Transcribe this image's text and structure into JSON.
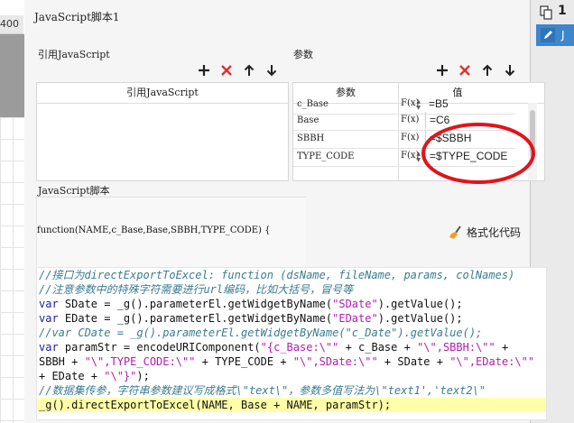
{
  "background": {
    "left_cell_text": "400",
    "right_number": "1",
    "right_item_text": "J"
  },
  "dialog": {
    "title": "JavaScript脚本1",
    "lib_section_label": "引用JavaScript",
    "params_section_label": "参数",
    "lib_table_header": "引用JavaScript",
    "params_header_name": "参数",
    "params_header_value": "值",
    "params": [
      {
        "name": "c_Base",
        "fx": "F(x)",
        "value": "=B5"
      },
      {
        "name": "Base",
        "fx": "F(x)",
        "value": "=C6"
      },
      {
        "name": "SBBH",
        "fx": "F(x)",
        "value": "=$SBBH"
      },
      {
        "name": "TYPE_CODE",
        "fx": "F(x)",
        "value": "=$TYPE_CODE"
      }
    ],
    "script_section_label": "JavaScript脚本",
    "function_signature": "function(NAME,c_Base,Base,SBBH,TYPE_CODE) {",
    "format_button_label": "格式化代码",
    "code_lines": [
      {
        "kind": "comment",
        "parts": [
          {
            "t": "cm",
            "s": "//接口为directExportToExcel: function (dsName, fileName, params, colNames)"
          }
        ]
      },
      {
        "kind": "comment",
        "parts": [
          {
            "t": "cm",
            "s": "//注意参数中的特殊字符需要进行url编码，比如大括号，冒号等"
          }
        ]
      },
      {
        "kind": "code",
        "parts": [
          {
            "t": "kw",
            "s": "var"
          },
          {
            "t": "tx",
            "s": " SDate = _g().parameterEl.getWidgetByName("
          },
          {
            "t": "str",
            "s": "\"SDate\""
          },
          {
            "t": "tx",
            "s": ").getValue();"
          }
        ]
      },
      {
        "kind": "code",
        "parts": [
          {
            "t": "kw",
            "s": "var"
          },
          {
            "t": "tx",
            "s": " EDate = _g().parameterEl.getWidgetByName("
          },
          {
            "t": "str",
            "s": "\"EDate\""
          },
          {
            "t": "tx",
            "s": ").getValue();"
          }
        ]
      },
      {
        "kind": "comment",
        "parts": [
          {
            "t": "cm",
            "s": "//var CDate = _g().parameterEl.getWidgetByName(\"c_Date\").getValue();"
          }
        ]
      },
      {
        "kind": "code",
        "parts": [
          {
            "t": "kw",
            "s": "var"
          },
          {
            "t": "tx",
            "s": " paramStr = encodeURIComponent("
          },
          {
            "t": "str",
            "s": "\"{c_Base:\\\"\""
          },
          {
            "t": "tx",
            "s": " + c_Base + "
          },
          {
            "t": "str",
            "s": "\"\\\",SBBH:\\\"\""
          },
          {
            "t": "tx",
            "s": " +"
          }
        ]
      },
      {
        "kind": "code",
        "parts": [
          {
            "t": "tx",
            "s": "SBBH + "
          },
          {
            "t": "str",
            "s": "\"\\\",TYPE_CODE:\\\"\""
          },
          {
            "t": "tx",
            "s": " + TYPE_CODE + "
          },
          {
            "t": "str",
            "s": "\"\\\",SDate:\\\"\""
          },
          {
            "t": "tx",
            "s": " + SDate + "
          },
          {
            "t": "str",
            "s": "\"\\\",EDate:\\\"\""
          }
        ]
      },
      {
        "kind": "code",
        "parts": [
          {
            "t": "tx",
            "s": "+ EDate + "
          },
          {
            "t": "str",
            "s": "\"\\\"}\""
          },
          {
            "t": "tx",
            "s": ");"
          }
        ]
      },
      {
        "kind": "comment",
        "parts": [
          {
            "t": "cm",
            "s": "//数据集传参，字符串参数建议写成格式\\\"text\\\"，参数多值写法为\\\"text1','text2\\\""
          }
        ]
      },
      {
        "kind": "code",
        "highlight": true,
        "parts": [
          {
            "t": "tx",
            "s": "_g().directExportToExcel(NAME, Base + NAME, paramStr);"
          }
        ]
      }
    ]
  },
  "icons": {
    "add": "plus-icon",
    "delete": "delete-x-icon",
    "up": "arrow-up-icon",
    "down": "arrow-down-icon",
    "format": "broom-icon"
  },
  "colors": {
    "delete_red": "#e03030",
    "annotation_red": "#e0151b",
    "comment": "#3b7c8f",
    "keyword": "#1a1aa6",
    "string": "#b21bb2",
    "highlight": "#ffffaa",
    "selection_blue": "#3d86cc"
  }
}
